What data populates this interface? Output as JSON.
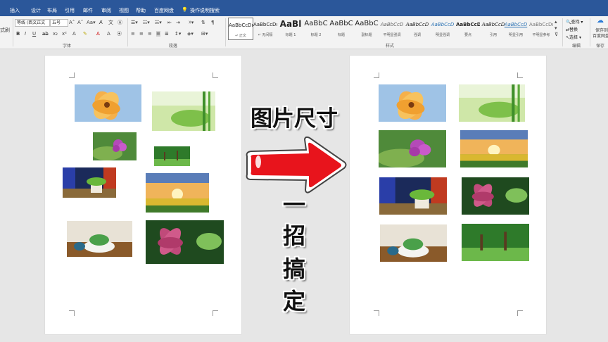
{
  "ribbon_tabs": [
    "插入",
    "设计",
    "布局",
    "引用",
    "邮件",
    "审阅",
    "视图",
    "帮助",
    "百度网盘",
    "操作说明搜索"
  ],
  "font_group": {
    "font_name": "等线 (西文正文",
    "font_size": "五号",
    "label": "字体"
  },
  "paragraph_group": {
    "label": "段落"
  },
  "styles_group": {
    "label": "样式",
    "styles": [
      {
        "sample": "AaBbCcDı",
        "name": "↵ 正文"
      },
      {
        "sample": "AaBbCcDı",
        "name": "↵ 无间隔"
      },
      {
        "sample": "AaBl",
        "name": "标题 1"
      },
      {
        "sample": "AaBbC",
        "name": "标题 2"
      },
      {
        "sample": "AaBbC",
        "name": "标题"
      },
      {
        "sample": "AaBbC",
        "name": "副标题"
      },
      {
        "sample": "AaBbCcD",
        "name": "不明显强调"
      },
      {
        "sample": "AaBbCcD",
        "name": "强调"
      },
      {
        "sample": "AaBbCcD",
        "name": "明显强调"
      },
      {
        "sample": "AaBbCcD",
        "name": "要点"
      },
      {
        "sample": "AaBbCcD",
        "name": "引用"
      },
      {
        "sample": "AaBbCcD",
        "name": "明显引用"
      },
      {
        "sample": "AaBbCcDı",
        "name": "不明显参考"
      }
    ]
  },
  "editing_group": {
    "find": "查找",
    "replace": "替换",
    "select": "选择",
    "label": "编辑"
  },
  "save_group": {
    "line1": "保存到",
    "line2": "百度网盘",
    "label": "保存"
  },
  "left_edge": {
    "clipboard_text": "式刷"
  },
  "overlay": {
    "headline": "图片尺寸",
    "vertical_chars": [
      "一",
      "招",
      "搞",
      "定"
    ]
  },
  "colors": {
    "ribbon_blue": "#2b579a",
    "arrow_red": "#e8141c",
    "page_bg": "#ffffff",
    "workspace_bg": "#e6e6e6"
  }
}
